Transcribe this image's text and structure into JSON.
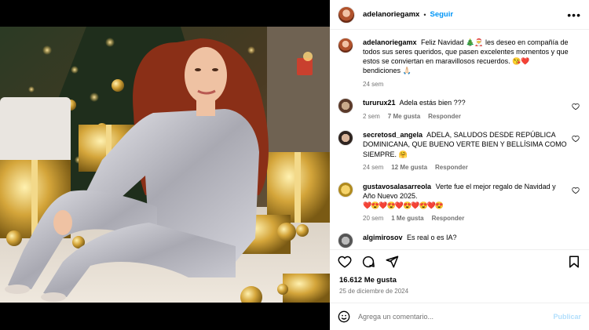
{
  "header": {
    "username": "adelanoriegamx",
    "separator": "•",
    "follow_label": "Seguir",
    "more_icon": "more-horizontal-icon"
  },
  "caption": {
    "username": "adelanoriegamx",
    "text": "Feliz Navidad 🎄🎅 les deseo en compañía de todos sus seres queridos, que pasen excelentes momentos y que estos se conviertan en maravillosos recuerdos. 😘❤️ bendiciones 🙏🏻",
    "time": "24 sem"
  },
  "comments": [
    {
      "username": "tururux21",
      "text": "Adela estás bien ???",
      "time": "2 sem",
      "likes": "7 Me gusta",
      "reply": "Responder"
    },
    {
      "username": "secretosd_angela",
      "text": "ADELA, SALUDOS DESDE REPÚBLICA DOMINICANA, QUE BUENO VERTE BIEN Y BELLÍSIMA COMO SIEMPRE. 🤗",
      "time": "24 sem",
      "likes": "12 Me gusta",
      "reply": "Responder"
    },
    {
      "username": "gustavosalasarreola",
      "text": "Verte fue el mejor regalo de Navidad y Año Nuevo 2025.",
      "emojis": "❤️😍❤️😍❤️😍❤️😍❤️😍",
      "time": "20 sem",
      "likes": "1 Me gusta",
      "reply": "Responder"
    },
    {
      "username": "algimirosov",
      "text": "Es real o es IA?"
    }
  ],
  "post": {
    "likes": "16.612 Me gusta",
    "date": "25 de diciembre de 2024"
  },
  "add_comment": {
    "placeholder": "Agrega un comentario...",
    "publish_label": "Publicar"
  },
  "colors": {
    "accent": "#0095f6",
    "publish_disabled": "#b2dffc",
    "muted": "#737373"
  }
}
